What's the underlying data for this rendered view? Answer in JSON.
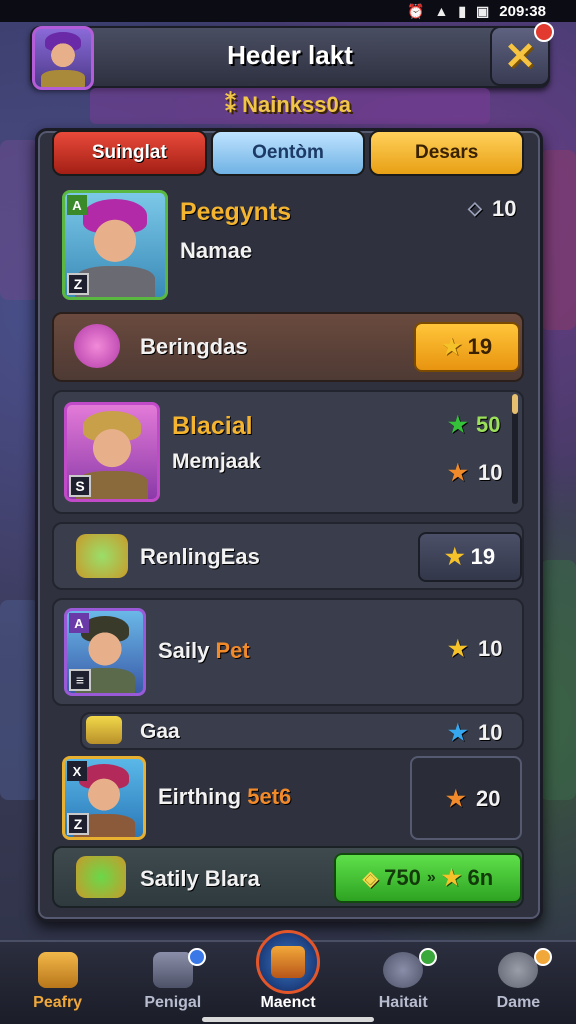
{
  "status_bar": {
    "time": "209:38"
  },
  "header": {
    "title": "Heder lakt"
  },
  "subtitle": "⁑ Nainkss0a",
  "tabs": [
    {
      "label": "Suinglat",
      "color": "#c4301f"
    },
    {
      "label": "Oentòm",
      "color": "#8cc8f0"
    },
    {
      "label": "Desars",
      "color": "#f2b22a"
    }
  ],
  "rows": {
    "hero1": {
      "name": "Peegynts",
      "sub": "Namae",
      "value": "10",
      "badge": "Z",
      "badge_top": "A"
    },
    "reward1": {
      "label": "Beringdas",
      "value": "19"
    },
    "hero2": {
      "name": "Blacial",
      "sub": "Memjaak",
      "value_green": "50",
      "value_orange": "10",
      "badge": "S"
    },
    "reward2": {
      "label": "RenlingEas",
      "value": "19"
    },
    "hero3": {
      "name_white": "Saily",
      "name_orange": "Pet",
      "value": "10",
      "badge_top": "A"
    },
    "reward3": {
      "label": "Gaa",
      "value": "10"
    },
    "hero4": {
      "name_white": "Eirthing",
      "name_orange": "5et6",
      "value": "20",
      "badge_top": "X",
      "badge": "Z"
    },
    "reward4": {
      "label": "Satily Blara",
      "value_left": "750",
      "value_right": "6n"
    }
  },
  "bottom_nav": [
    {
      "label": "Peafry",
      "icon": "chest-icon",
      "color": "#f0a83a"
    },
    {
      "label": "Penigal",
      "icon": "camera-icon",
      "color": "#b8bccf"
    },
    {
      "label": "Maenct",
      "icon": "treasure-map-icon",
      "color": "#ffffff"
    },
    {
      "label": "Haitait",
      "icon": "shield-icon",
      "color": "#b8bccf"
    },
    {
      "label": "Dame",
      "icon": "dice-icon",
      "color": "#b8bccf"
    }
  ]
}
